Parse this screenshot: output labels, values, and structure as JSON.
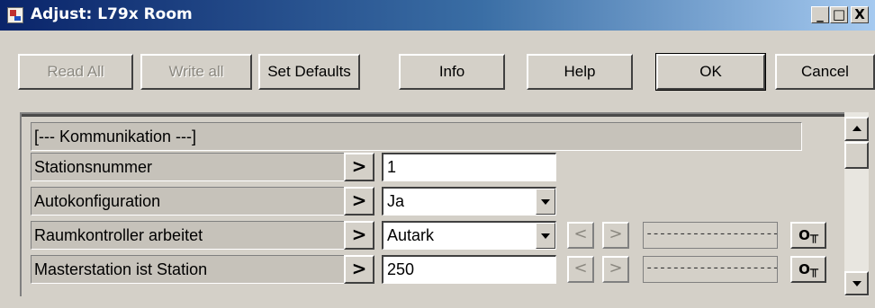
{
  "window": {
    "title": "Adjust: L79x Room",
    "minimize_glyph": "_",
    "maximize_glyph": "□",
    "close_glyph": "X"
  },
  "toolbar": {
    "read_all": "Read All",
    "write_all": "Write all",
    "set_defaults": "Set Defaults",
    "info": "Info",
    "help": "Help",
    "ok": "OK",
    "cancel": "Cancel"
  },
  "section": {
    "title": "[--- Kommunikation ---]"
  },
  "rows": [
    {
      "label": "Stationsnummer",
      "arrow": ">",
      "value": "1",
      "type": "input"
    },
    {
      "label": "Autokonfiguration",
      "arrow": ">",
      "value": "Ja",
      "type": "combo"
    },
    {
      "label": "Raumkontroller arbeitet",
      "arrow": ">",
      "value": "Autark",
      "type": "combo",
      "prev": "<",
      "next": ">",
      "remote": "--------------------",
      "key": "O╥"
    },
    {
      "label": "Masterstation ist Station",
      "arrow": ">",
      "value": "250",
      "type": "input",
      "prev": "<",
      "next": ">",
      "remote": "--------------------",
      "key": "O╥"
    }
  ],
  "colors": {
    "titlebar_start": "#0a246a",
    "titlebar_end": "#a6caf0",
    "face": "#d4d0c8",
    "disabled_text": "#8a877f"
  }
}
